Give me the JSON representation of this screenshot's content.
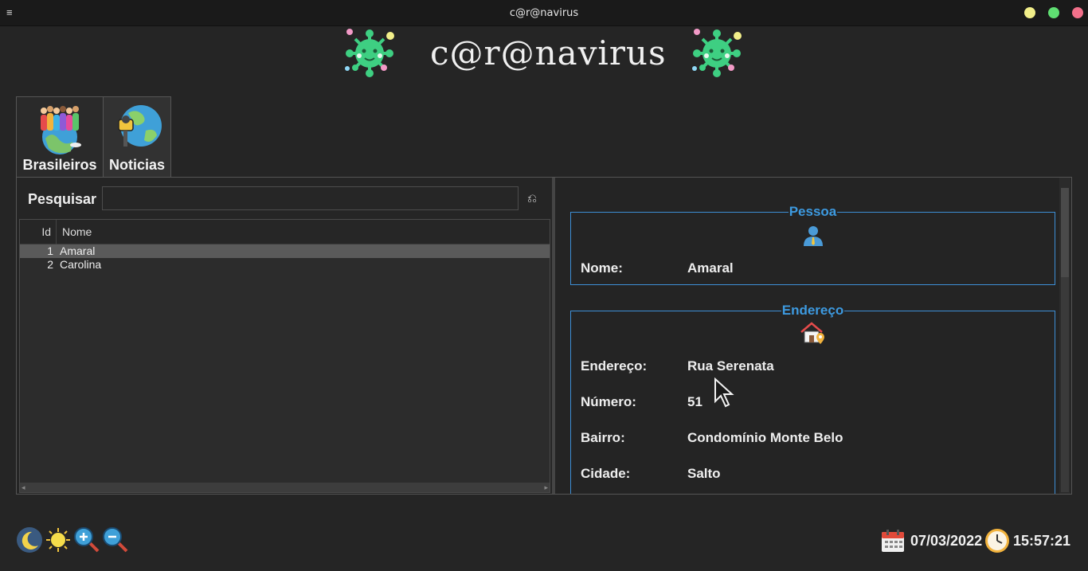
{
  "window": {
    "title": "c@r@navirus"
  },
  "header": {
    "app_title": "c@r@navirus"
  },
  "tabs": [
    {
      "label": "Brasileiros",
      "icon": "people-globe-icon"
    },
    {
      "label": "Noticias",
      "icon": "globe-microphone-icon"
    }
  ],
  "search": {
    "label": "Pesquisar",
    "value": "",
    "placeholder": ""
  },
  "table": {
    "columns": [
      "Id",
      "Nome"
    ],
    "rows": [
      {
        "id": "1",
        "nome": "Amaral",
        "selected": true
      },
      {
        "id": "2",
        "nome": "Carolina",
        "selected": false
      }
    ]
  },
  "pessoa": {
    "title": "Pessoa",
    "nome_label": "Nome:",
    "nome_value": "Amaral"
  },
  "endereco": {
    "title": "Endereço",
    "endereco_label": "Endereço:",
    "endereco_value": "Rua Serenata",
    "numero_label": "Número:",
    "numero_value": "51",
    "bairro_label": "Bairro:",
    "bairro_value": "Condomínio Monte Belo",
    "cidade_label": "Cidade:",
    "cidade_value": "Salto"
  },
  "status": {
    "date": "07/03/2022",
    "time": "15:57:21"
  },
  "colors": {
    "accent": "#3d9ae0",
    "background": "#252525",
    "virus": "#3ecf82"
  }
}
